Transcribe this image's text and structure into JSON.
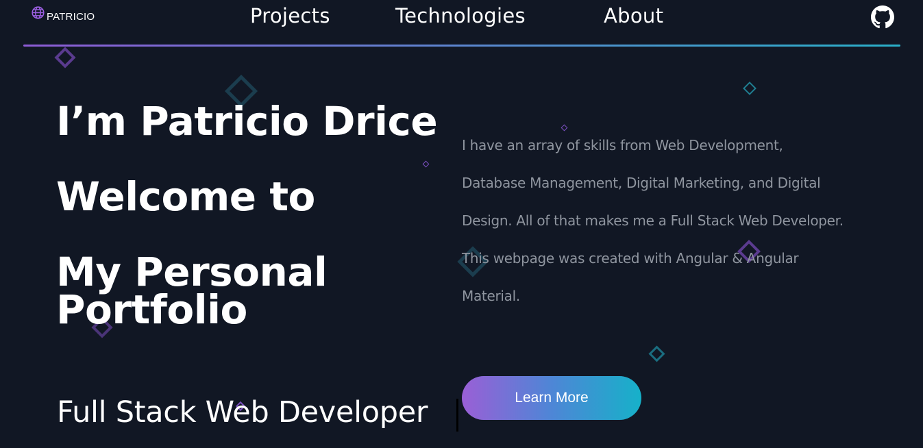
{
  "header": {
    "logo_text": "PATRICIO",
    "nav": {
      "projects": "Projects",
      "technologies": "Technologies",
      "about": "About"
    }
  },
  "hero": {
    "title_line1": "I’m Patricio Drice",
    "title_line2": "Welcome to",
    "title_line3": "My Personal Portfolio",
    "subtitle": "Full Stack Web Developer",
    "description": "I have an array of skills from Web Development, Database Management, Digital Marketing, and Digital Design. All of that makes me a Full Stack Web Developer. This webpage was created with Angular & Angular Material.",
    "cta_label": "Learn More"
  },
  "icons": {
    "logo": "globe-icon",
    "github": "github-icon"
  },
  "colors": {
    "background": "#111724",
    "accent_purple": "#8e5cd6",
    "accent_cyan": "#2ab0c9",
    "muted_text": "#8f959f"
  }
}
